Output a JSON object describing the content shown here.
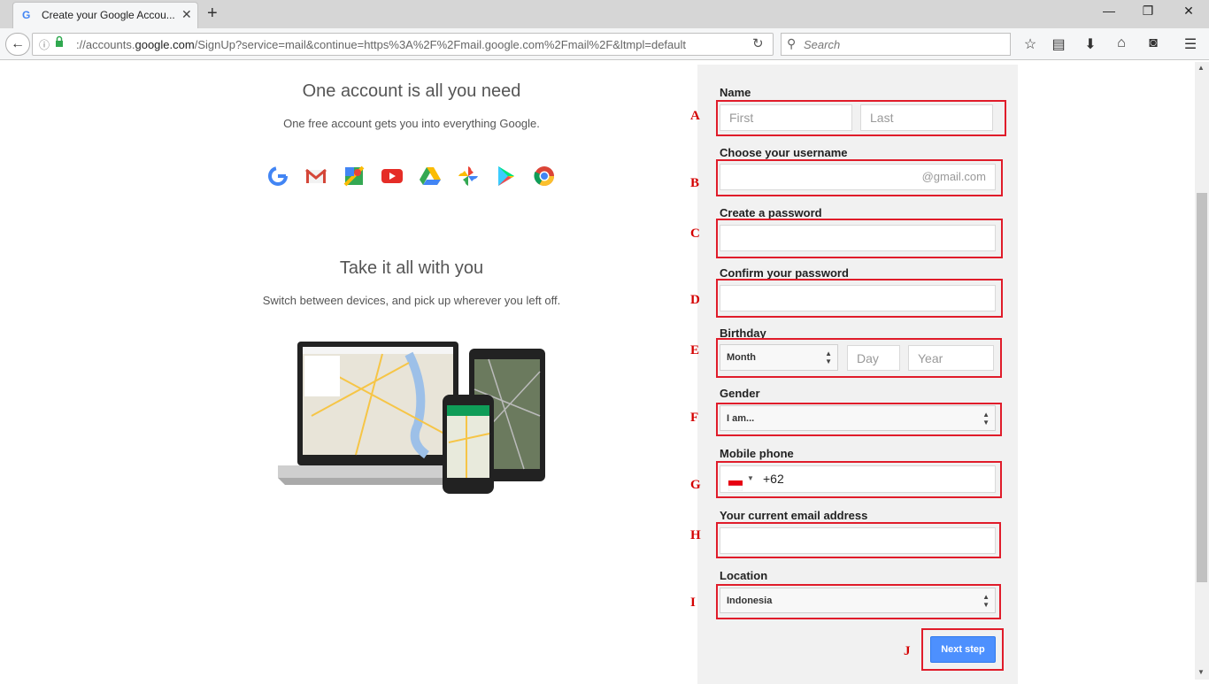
{
  "browser": {
    "tab_title": "Create your Google Accou...",
    "tab_close": "✕",
    "new_tab": "+",
    "url_prefix": "://accounts.",
    "url_domain": "google.com",
    "url_rest": "/SignUp?service=mail&continue=https%3A%2F%2Fmail.google.com%2Fmail%2F&ltmpl=default",
    "search_placeholder": "Search"
  },
  "left": {
    "heading1": "One account is all you need",
    "sub1": "One free account gets you into everything Google.",
    "heading2": "Take it all with you",
    "sub2": "Switch between devices, and pick up wherever you left off."
  },
  "form": {
    "name_label": "Name",
    "first_placeholder": "First",
    "last_placeholder": "Last",
    "username_label": "Choose your username",
    "gmail_suffix": "@gmail.com",
    "password_label": "Create a password",
    "confirm_label": "Confirm your password",
    "birthday_label": "Birthday",
    "month_value": "Month",
    "day_placeholder": "Day",
    "year_placeholder": "Year",
    "gender_label": "Gender",
    "gender_value": "I am...",
    "phone_label": "Mobile phone",
    "phone_value": "+62",
    "email_label": "Your current email address",
    "location_label": "Location",
    "location_value": "Indonesia",
    "next_button": "Next step"
  },
  "annotations": [
    "A",
    "B",
    "C",
    "D",
    "E",
    "F",
    "G",
    "H",
    "I",
    "J"
  ],
  "colors": {
    "annotation_red": "#e01c2a",
    "button_blue": "#4d90fe"
  }
}
